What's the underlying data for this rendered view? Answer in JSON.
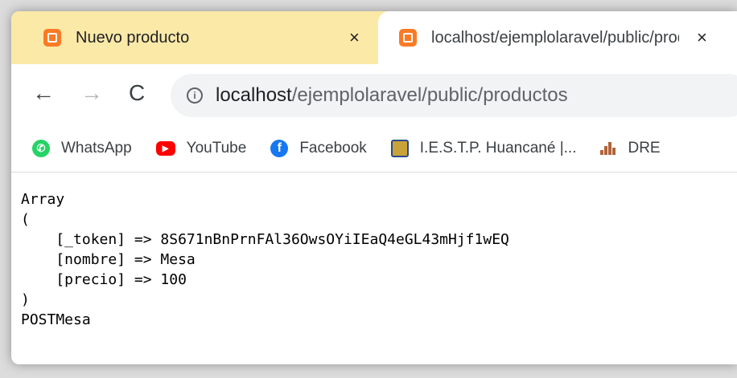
{
  "tabs": [
    {
      "title": "Nuevo producto",
      "close": "×"
    },
    {
      "title": "localhost/ejemplolaravel/public/productos",
      "close": "×"
    }
  ],
  "toolbar": {
    "back": "←",
    "forward": "→",
    "reload": "C",
    "info": "i",
    "url_host": "localhost",
    "url_path": "/ejemplolaravel/public/productos"
  },
  "bookmarks": [
    {
      "label": "WhatsApp",
      "icon": "whatsapp-icon"
    },
    {
      "label": "YouTube",
      "icon": "youtube-icon"
    },
    {
      "label": "Facebook",
      "icon": "facebook-icon"
    },
    {
      "label": "I.E.S.T.P. Huancané |...",
      "icon": "iestp-icon"
    },
    {
      "label": "DRE",
      "icon": "dre-icon"
    }
  ],
  "output": {
    "line1": "Array",
    "line2": "(",
    "line3": "    [_token] => 8S671nBnPrnFAl36OwsOYiIEaQ4eGL43mHjf1wEQ",
    "line4": "    [nombre] => Mesa",
    "line5": "    [precio] => 100",
    "line6": ")",
    "line7": "POSTMesa"
  },
  "colors": {
    "tabstrip": "#fbe9a8",
    "xampp": "#fb7a24",
    "omnibox": "#f1f3f4"
  }
}
